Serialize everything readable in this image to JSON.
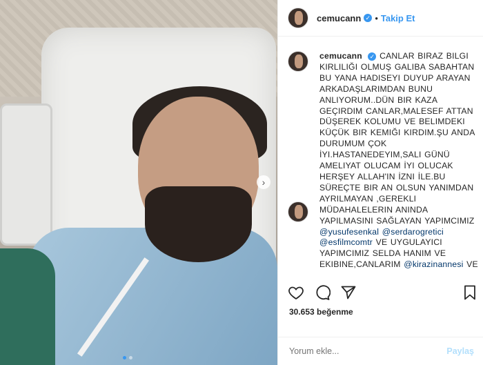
{
  "post": {
    "username": "cemucann",
    "verified_mark": "✓",
    "separator": "•",
    "follow_label": "Takip Et",
    "caption_user": "cemucann",
    "caption_body_1": "CANLAR BIRAZ BILGI KIRLILIĞI OLMUŞ GALIBA SABAHTAN BU YANA HADISEYI DUYUP ARAYAN ARKADAŞLARIMDAN BUNU ANLIYORUM..DÜN BIR KAZA GEÇIRDIM CANLAR,MALESEF ATTAN DÜŞEREK KOLUMU VE BELIMDEKI KÜÇÜK BIR KEMIĞI KIRDIM.ŞU ANDA DURUMUM ÇOK İYI.HASTANEDEYIM,SALI GÜNÜ AMELIYAT OLUCAM İYI OLUCAK HERŞEY ALLAH'IN İZNI İLE.BU SÜREÇTE BIR AN OLSUN YANIMDAN AYRILMAYAN ,GEREKLI MÜDAHALELERIN ANINDA YAPILMASINI SAĞLAYAN YAPIMCIMIZ",
    "mention_1": "@yusufesenkal",
    "mention_2": "@serdarogretici",
    "mention_3": "@esfilmcomtr",
    "caption_body_2": "VE UYGULAYICI YAPIMCIMIZ SELDA HANIM VE EKIBINE,CANLARIM",
    "mention_4": "@kirazinannesi",
    "caption_body_3": "VE",
    "likes": "30.653 beğenme",
    "comment_placeholder": "Yorum ekle...",
    "post_button": "Paylaş",
    "carousel_next": "›"
  },
  "icons": [
    "heart-icon",
    "comment-icon",
    "share-icon",
    "bookmark-icon",
    "verified-icon",
    "chevron-right-icon"
  ],
  "colors": {
    "accent": "#3897f0",
    "mention": "#003569",
    "border": "#efefef"
  }
}
